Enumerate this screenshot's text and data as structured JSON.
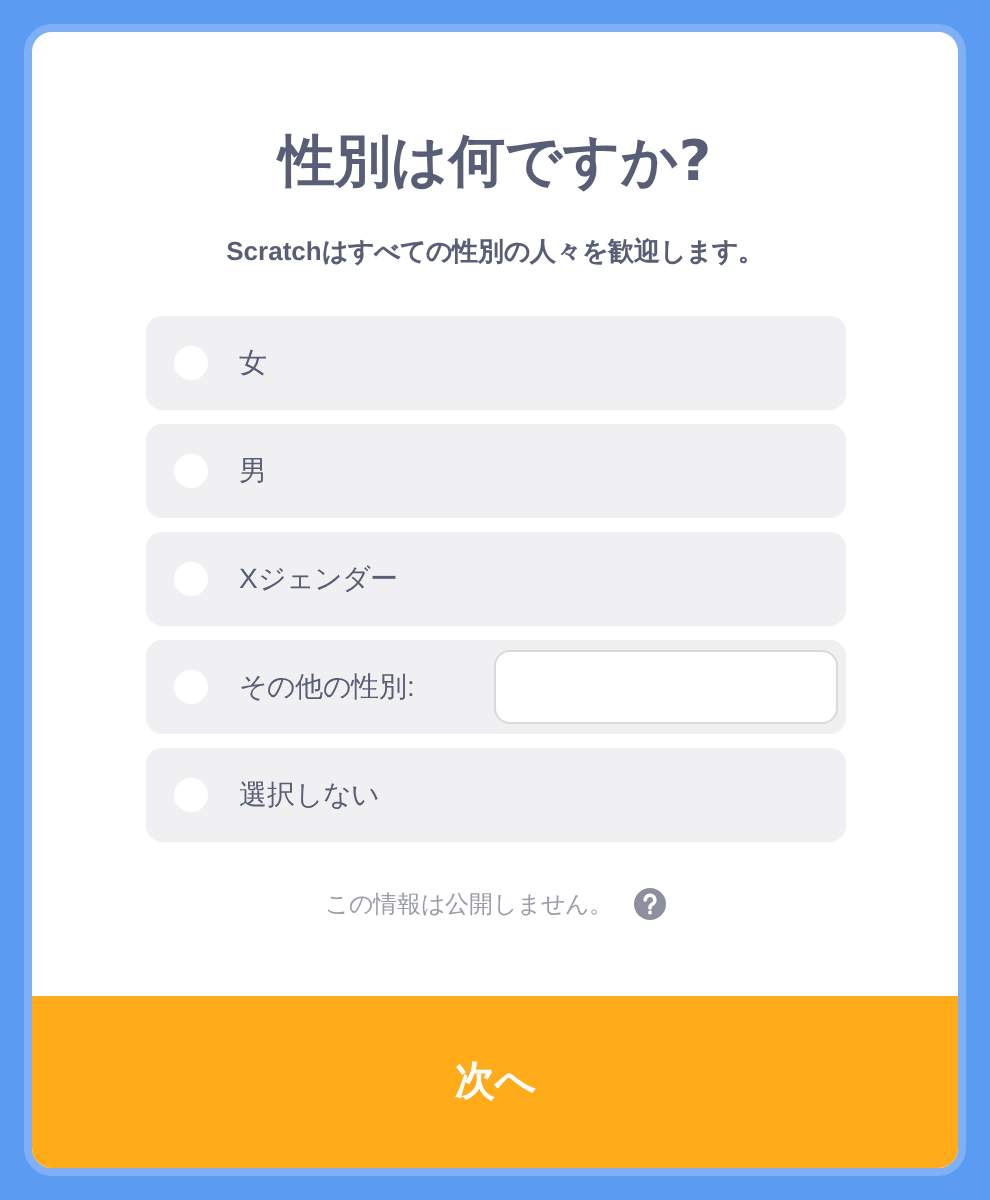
{
  "title": "性別は何ですか?",
  "subtitle": "Scratchはすべての性別の人々を歓迎します。",
  "options": [
    {
      "kind": "plain",
      "label": "女",
      "selected": false
    },
    {
      "kind": "plain",
      "label": "男",
      "selected": false
    },
    {
      "kind": "plain",
      "label": "Xジェンダー",
      "selected": false
    },
    {
      "kind": "text",
      "label": "その他の性別:",
      "selected": false
    },
    {
      "kind": "plain",
      "label": "選択しない",
      "selected": false
    }
  ],
  "privacy_note": "この情報は公開しません。",
  "next_button": "次へ"
}
